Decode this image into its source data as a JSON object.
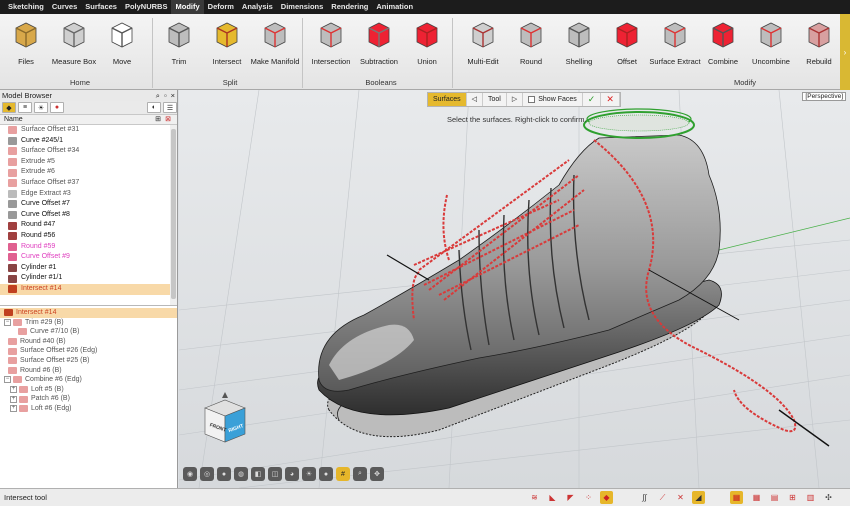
{
  "menu": [
    "Sketching",
    "Curves",
    "Surfaces",
    "PolyNURBS",
    "Modify",
    "Deform",
    "Analysis",
    "Dimensions",
    "Rendering",
    "Animation"
  ],
  "menu_active": "Modify",
  "ribbon": {
    "tools": [
      {
        "label": "Files",
        "icon": "files-icon"
      },
      {
        "label": "Measure Box",
        "icon": "measure-box-icon"
      },
      {
        "label": "Move",
        "icon": "move-icon"
      },
      {
        "label": "Trim",
        "icon": "trim-icon"
      },
      {
        "label": "Intersect",
        "icon": "intersect-icon"
      },
      {
        "label": "Make Manifold",
        "icon": "make-manifold-icon"
      },
      {
        "label": "Intersection",
        "icon": "boolean-intersection-icon"
      },
      {
        "label": "Subtraction",
        "icon": "boolean-subtraction-icon"
      },
      {
        "label": "Union",
        "icon": "boolean-union-icon"
      },
      {
        "label": "Multi-Edit",
        "icon": "multi-edit-icon"
      },
      {
        "label": "Round",
        "icon": "round-icon"
      },
      {
        "label": "Shelling",
        "icon": "shelling-icon"
      },
      {
        "label": "Offset",
        "icon": "offset-icon"
      },
      {
        "label": "Surface Extract",
        "icon": "surface-extract-icon"
      },
      {
        "label": "Combine",
        "icon": "combine-icon"
      },
      {
        "label": "Uncombine",
        "icon": "uncombine-icon"
      },
      {
        "label": "Rebuild",
        "icon": "rebuild-icon"
      }
    ],
    "groups": [
      "Home",
      "Split",
      "Booleans",
      "Modify"
    ]
  },
  "model_browser": {
    "title": "Model Browser",
    "column": "Name",
    "items": [
      {
        "label": "Surface Offset #31",
        "style": "dim",
        "color": "#e8a0a0"
      },
      {
        "label": "Curve #245/1",
        "style": "bold",
        "color": "#999999"
      },
      {
        "label": "Surface Offset #34",
        "style": "dim",
        "color": "#e8a0a0"
      },
      {
        "label": "Extrude #5",
        "style": "dim",
        "color": "#e8a0a0"
      },
      {
        "label": "Extrude #6",
        "style": "dim",
        "color": "#e8a0a0"
      },
      {
        "label": "Surface Offset #37",
        "style": "dim",
        "color": "#e8a0a0"
      },
      {
        "label": "Edge Extract #3",
        "style": "dim",
        "color": "#bbbbbb"
      },
      {
        "label": "Curve Offset #7",
        "style": "bold",
        "color": "#999999"
      },
      {
        "label": "Curve Offset #8",
        "style": "bold",
        "color": "#999999"
      },
      {
        "label": "Round #47",
        "style": "bold",
        "color": "#a04040"
      },
      {
        "label": "Round #56",
        "style": "bold",
        "color": "#a04040"
      },
      {
        "label": "Round #59",
        "style": "pink",
        "color": "#e06090"
      },
      {
        "label": "Curve Offset #9",
        "style": "pink",
        "color": "#e06090"
      },
      {
        "label": "Cylinder #1",
        "style": "bold",
        "color": "#884444"
      },
      {
        "label": "Cylinder #1/1",
        "style": "bold",
        "color": "#884444"
      },
      {
        "label": "Intersect #14",
        "style": "sel",
        "color": "#c04020"
      }
    ],
    "tree": [
      {
        "label": "Intersect #14",
        "indent": 0,
        "sel": true,
        "exp": ""
      },
      {
        "label": "Trim #29 (B)",
        "indent": 0,
        "sel": false,
        "exp": "−"
      },
      {
        "label": "Curve #7/10 (B)",
        "indent": 14,
        "sel": false,
        "exp": ""
      },
      {
        "label": "Round #40 (B)",
        "indent": 4,
        "sel": false,
        "exp": ""
      },
      {
        "label": "Surface Offset #26 (Edg)",
        "indent": 4,
        "sel": false,
        "exp": ""
      },
      {
        "label": "Surface Offset #25 (B)",
        "indent": 4,
        "sel": false,
        "exp": ""
      },
      {
        "label": "Round #6 (B)",
        "indent": 4,
        "sel": false,
        "exp": ""
      },
      {
        "label": "Combine #6 (Edg)",
        "indent": 0,
        "sel": false,
        "exp": "−"
      },
      {
        "label": "Loft #5 (B)",
        "indent": 6,
        "sel": false,
        "exp": "+"
      },
      {
        "label": "Patch #6 (B)",
        "indent": 6,
        "sel": false,
        "exp": "+"
      },
      {
        "label": "Loft #6 (Edg)",
        "indent": 6,
        "sel": false,
        "exp": "+"
      }
    ]
  },
  "selection_toolbar": {
    "surfaces": "Surfaces",
    "tool": "Tool",
    "show_faces": "Show Faces"
  },
  "viewport": {
    "prompt": "Select the surfaces. Right-click to confirm.",
    "projection": "[Perspective]",
    "cube_front": "FRONT",
    "cube_right": "RIGHT"
  },
  "status": {
    "text": "Intersect tool"
  },
  "colors": {
    "accent": "#e5b92e",
    "lace": "#d93a3a",
    "selection_green": "#2fa02f"
  }
}
